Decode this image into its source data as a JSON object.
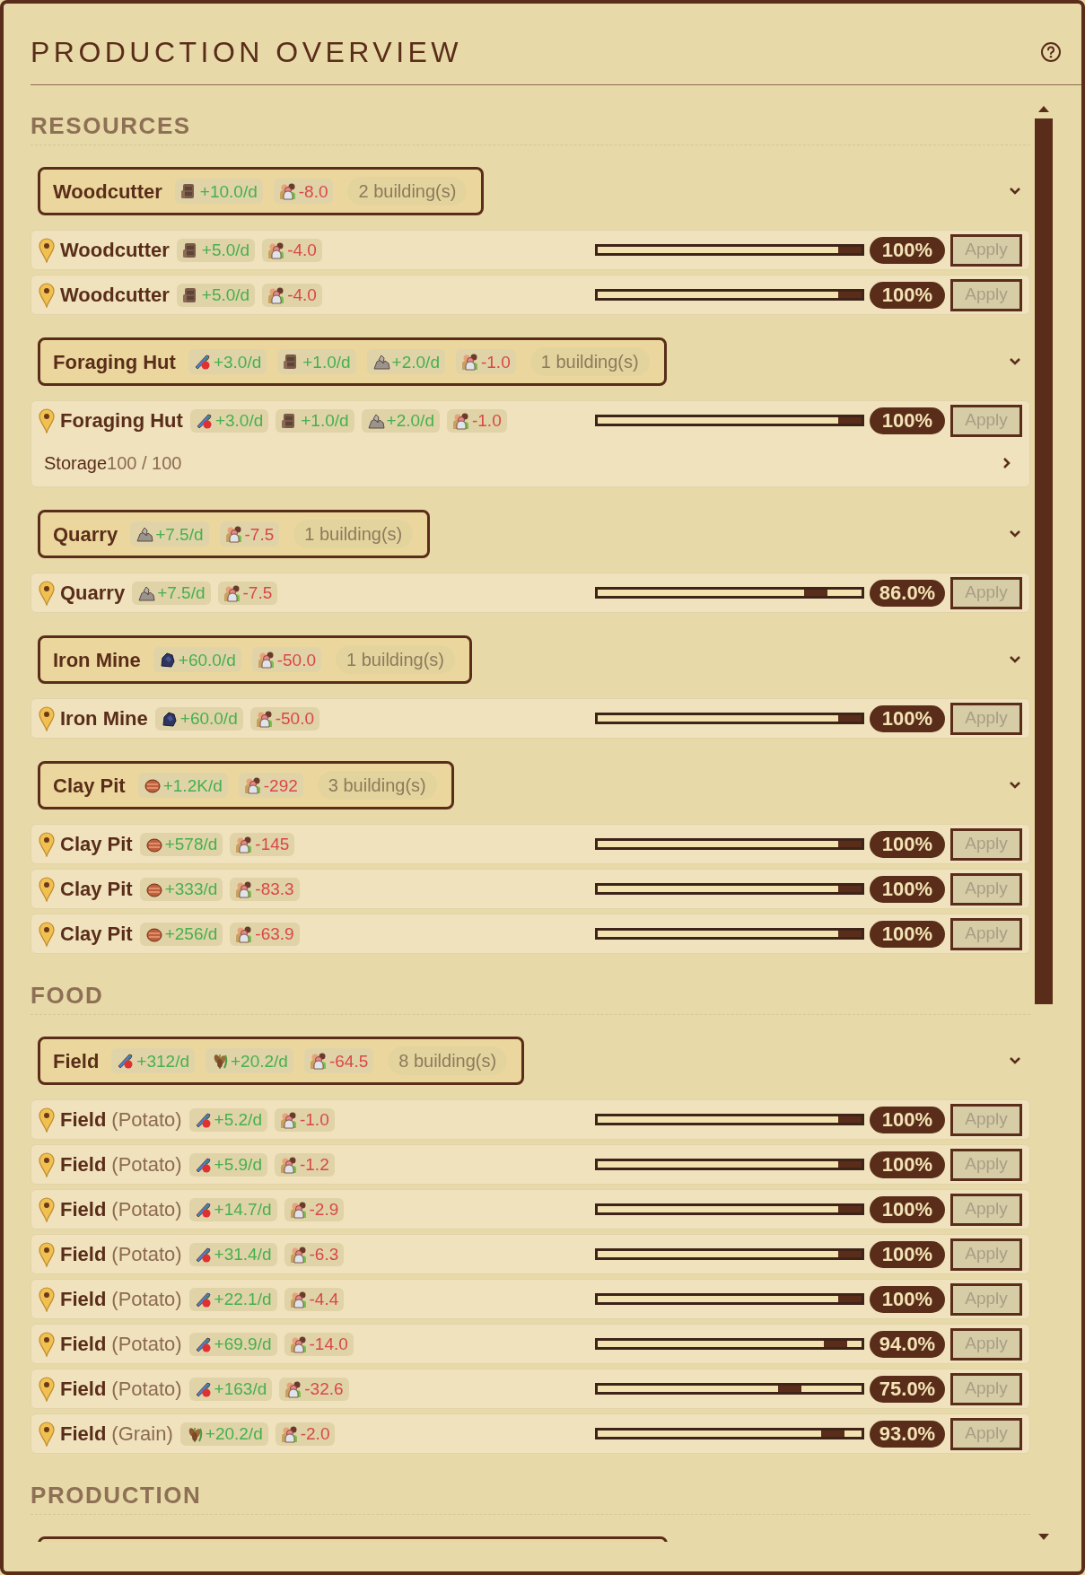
{
  "title": "PRODUCTION OVERVIEW",
  "sections": [
    {
      "title": "RESOURCES",
      "groups": [
        {
          "name": "Woodcutter",
          "expanded": true,
          "stats": [
            {
              "kind": "wood",
              "value": "+10.0/d"
            },
            {
              "kind": "workers",
              "value": "-8.0"
            }
          ],
          "buildings": "2 building(s)",
          "rows": [
            {
              "name": "Woodcutter",
              "stats": [
                {
                  "kind": "wood",
                  "value": "+5.0/d"
                },
                {
                  "kind": "workers",
                  "value": "-4.0"
                }
              ],
              "level": 1,
              "percent": "100%",
              "button": {
                "label": "Apply",
                "disabled": true
              }
            },
            {
              "name": "Woodcutter",
              "stats": [
                {
                  "kind": "wood",
                  "value": "+5.0/d"
                },
                {
                  "kind": "workers",
                  "value": "-4.0"
                }
              ],
              "level": 1,
              "percent": "100%",
              "button": {
                "label": "Apply",
                "disabled": true
              }
            }
          ]
        },
        {
          "name": "Foraging Hut",
          "expanded": true,
          "stats": [
            {
              "kind": "food",
              "value": "+3.0/d"
            },
            {
              "kind": "wood",
              "value": "+1.0/d"
            },
            {
              "kind": "stone",
              "value": "+2.0/d"
            },
            {
              "kind": "workers",
              "value": "-1.0"
            }
          ],
          "buildings": "1 building(s)",
          "rows": [
            {
              "name": "Foraging Hut",
              "stats": [
                {
                  "kind": "food",
                  "value": "+3.0/d"
                },
                {
                  "kind": "wood",
                  "value": "+1.0/d"
                },
                {
                  "kind": "stone",
                  "value": "+2.0/d"
                },
                {
                  "kind": "workers",
                  "value": "-1.0"
                }
              ],
              "level": 1,
              "percent": "100%",
              "button": {
                "label": "Apply",
                "disabled": true
              },
              "storage": {
                "label": "Storage",
                "value": "100 / 100",
                "expanded": false
              }
            }
          ]
        },
        {
          "name": "Quarry",
          "expanded": true,
          "stats": [
            {
              "kind": "stone",
              "value": "+7.5/d"
            },
            {
              "kind": "workers",
              "value": "-7.5"
            }
          ],
          "buildings": "1 building(s)",
          "rows": [
            {
              "name": "Quarry",
              "stats": [
                {
                  "kind": "stone",
                  "value": "+7.5/d"
                },
                {
                  "kind": "workers",
                  "value": "-7.5"
                }
              ],
              "level": 0.86,
              "percent": "86.0%",
              "button": {
                "label": "Apply",
                "disabled": true
              }
            }
          ]
        },
        {
          "name": "Iron Mine",
          "expanded": true,
          "stats": [
            {
              "kind": "iron",
              "value": "+60.0/d"
            },
            {
              "kind": "workers",
              "value": "-50.0"
            }
          ],
          "buildings": "1 building(s)",
          "rows": [
            {
              "name": "Iron Mine",
              "stats": [
                {
                  "kind": "iron",
                  "value": "+60.0/d"
                },
                {
                  "kind": "workers",
                  "value": "-50.0"
                }
              ],
              "level": 1,
              "percent": "100%",
              "button": {
                "label": "Apply",
                "disabled": true
              }
            }
          ]
        },
        {
          "name": "Clay Pit",
          "expanded": true,
          "stats": [
            {
              "kind": "clay",
              "value": "+1.2K/d"
            },
            {
              "kind": "workers",
              "value": "-292"
            }
          ],
          "buildings": "3 building(s)",
          "rows": [
            {
              "name": "Clay Pit",
              "stats": [
                {
                  "kind": "clay",
                  "value": "+578/d"
                },
                {
                  "kind": "workers",
                  "value": "-145"
                }
              ],
              "level": 1,
              "percent": "100%",
              "button": {
                "label": "Apply",
                "disabled": true
              }
            },
            {
              "name": "Clay Pit",
              "stats": [
                {
                  "kind": "clay",
                  "value": "+333/d"
                },
                {
                  "kind": "workers",
                  "value": "-83.3"
                }
              ],
              "level": 1,
              "percent": "100%",
              "button": {
                "label": "Apply",
                "disabled": true
              }
            },
            {
              "name": "Clay Pit",
              "stats": [
                {
                  "kind": "clay",
                  "value": "+256/d"
                },
                {
                  "kind": "workers",
                  "value": "-63.9"
                }
              ],
              "level": 1,
              "percent": "100%",
              "button": {
                "label": "Apply",
                "disabled": true
              }
            }
          ]
        }
      ]
    },
    {
      "title": "FOOD",
      "groups": [
        {
          "name": "Field",
          "expanded": true,
          "stats": [
            {
              "kind": "food",
              "value": "+312/d"
            },
            {
              "kind": "grain",
              "value": "+20.2/d"
            },
            {
              "kind": "workers",
              "value": "-64.5"
            }
          ],
          "buildings": "8 building(s)",
          "rows": [
            {
              "name": "Field",
              "variant": "(Potato)",
              "stats": [
                {
                  "kind": "food",
                  "value": "+5.2/d"
                },
                {
                  "kind": "workers",
                  "value": "-1.0"
                }
              ],
              "level": 1,
              "percent": "100%",
              "button": {
                "label": "Apply",
                "disabled": true
              }
            },
            {
              "name": "Field",
              "variant": "(Potato)",
              "stats": [
                {
                  "kind": "food",
                  "value": "+5.9/d"
                },
                {
                  "kind": "workers",
                  "value": "-1.2"
                }
              ],
              "level": 1,
              "percent": "100%",
              "button": {
                "label": "Apply",
                "disabled": true
              }
            },
            {
              "name": "Field",
              "variant": "(Potato)",
              "stats": [
                {
                  "kind": "food",
                  "value": "+14.7/d"
                },
                {
                  "kind": "workers",
                  "value": "-2.9"
                }
              ],
              "level": 1,
              "percent": "100%",
              "button": {
                "label": "Apply",
                "disabled": true
              }
            },
            {
              "name": "Field",
              "variant": "(Potato)",
              "stats": [
                {
                  "kind": "food",
                  "value": "+31.4/d"
                },
                {
                  "kind": "workers",
                  "value": "-6.3"
                }
              ],
              "level": 1,
              "percent": "100%",
              "button": {
                "label": "Apply",
                "disabled": true
              }
            },
            {
              "name": "Field",
              "variant": "(Potato)",
              "stats": [
                {
                  "kind": "food",
                  "value": "+22.1/d"
                },
                {
                  "kind": "workers",
                  "value": "-4.4"
                }
              ],
              "level": 1,
              "percent": "100%",
              "button": {
                "label": "Apply",
                "disabled": true
              }
            },
            {
              "name": "Field",
              "variant": "(Potato)",
              "stats": [
                {
                  "kind": "food",
                  "value": "+69.9/d"
                },
                {
                  "kind": "workers",
                  "value": "-14.0"
                }
              ],
              "level": 0.94,
              "percent": "94.0%",
              "button": {
                "label": "Apply",
                "disabled": true
              }
            },
            {
              "name": "Field",
              "variant": "(Potato)",
              "stats": [
                {
                  "kind": "food",
                  "value": "+163/d"
                },
                {
                  "kind": "workers",
                  "value": "-32.6"
                }
              ],
              "level": 0.75,
              "percent": "75.0%",
              "button": {
                "label": "Apply",
                "disabled": true
              }
            },
            {
              "name": "Field",
              "variant": "(Grain)",
              "stats": [
                {
                  "kind": "grain",
                  "value": "+20.2/d"
                },
                {
                  "kind": "workers",
                  "value": "-2.0"
                }
              ],
              "level": 0.93,
              "percent": "93.0%",
              "button": {
                "label": "Apply",
                "disabled": true
              }
            }
          ]
        }
      ]
    },
    {
      "title": "PRODUCTION",
      "groups": [
        {
          "cut_off": true
        }
      ]
    }
  ]
}
